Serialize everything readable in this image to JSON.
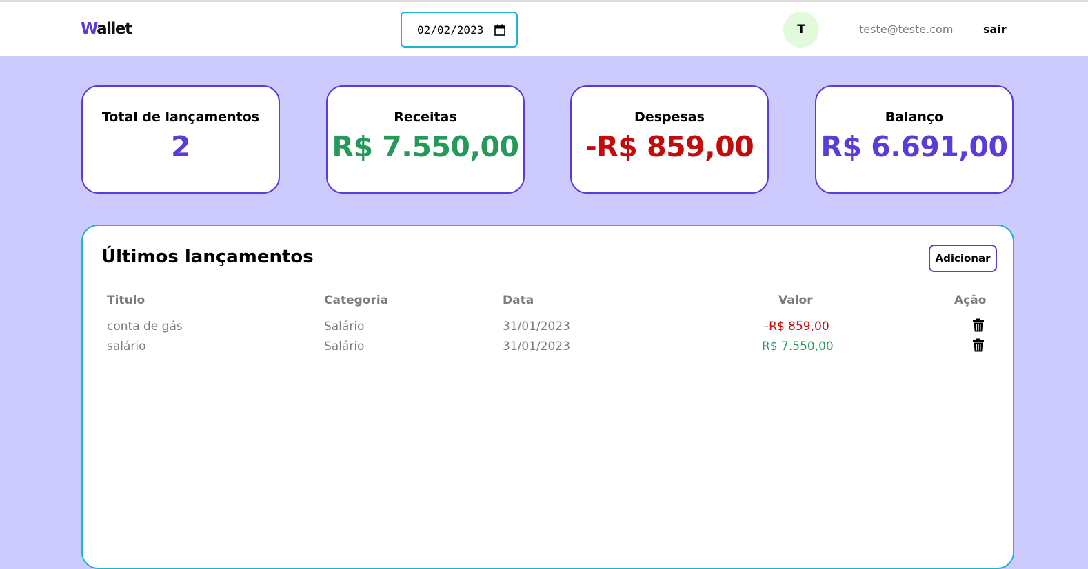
{
  "header": {
    "logo_prefix": "W",
    "logo_rest": "allet",
    "date_value": "02/02/2023",
    "avatar_initial": "T",
    "email": "teste@teste.com",
    "logout_label": "sair"
  },
  "cards": [
    {
      "label": "Total de lançamentos",
      "value": "2",
      "color": "#5b3bd9"
    },
    {
      "label": "Receitas",
      "value": "R$ 7.550,00",
      "color": "#25995a"
    },
    {
      "label": "Despesas",
      "value": "-R$ 859,00",
      "color": "#c40a0a"
    },
    {
      "label": "Balanço",
      "value": "R$ 6.691,00",
      "color": "#5b3bd9"
    }
  ],
  "panel": {
    "title": "Últimos lançamentos",
    "add_label": "Adicionar",
    "columns": [
      "Titulo",
      "Categoria",
      "Data",
      "Valor",
      "Ação"
    ],
    "rows": [
      {
        "title": "conta de gás",
        "category": "Salário",
        "date": "31/01/2023",
        "value": "-R$ 859,00",
        "type": "expense"
      },
      {
        "title": "salário",
        "category": "Salário",
        "date": "31/01/2023",
        "value": "R$ 7.550,00",
        "type": "income"
      }
    ]
  },
  "colors": {
    "accent": "#5b3bd9",
    "cyan": "#1eb3d4",
    "income": "#25995a",
    "expense": "#c40a0a",
    "background": "#cdcbfd"
  }
}
